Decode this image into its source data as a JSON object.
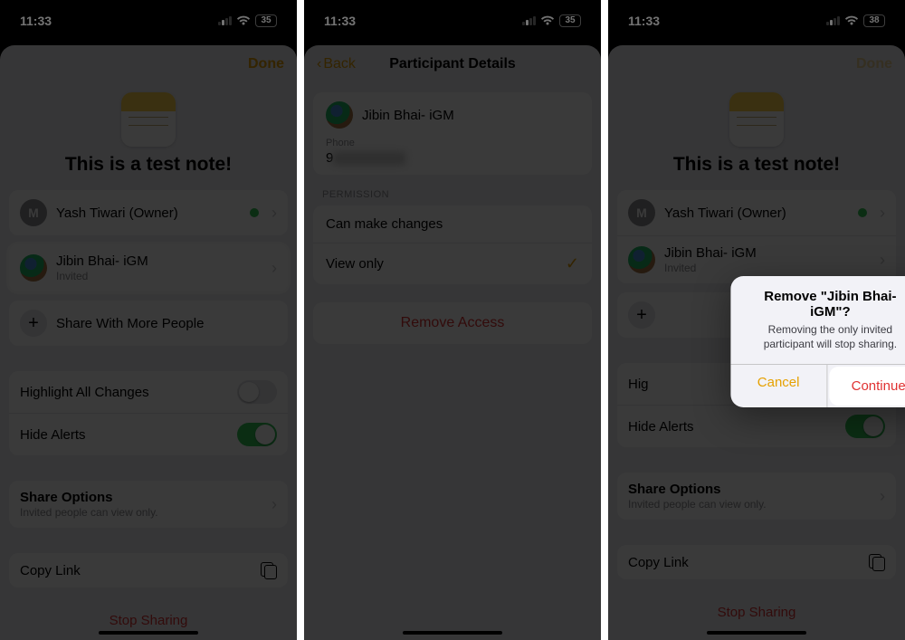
{
  "status": {
    "time": "11:33",
    "battery": "35",
    "battery3": "38"
  },
  "common": {
    "noteTitle": "This is a test note!",
    "done": "Done",
    "ownerInitial": "M",
    "ownerName": "Yash Tiwari (Owner)",
    "participantName": "Jibin Bhai- iGM",
    "participantStatus": "Invited",
    "shareMore": "Share With More People",
    "highlightChanges": "Highlight All Changes",
    "hideAlerts": "Hide Alerts",
    "shareOptionsTitle": "Share Options",
    "shareOptionsSub": "Invited people can view only.",
    "copyLink": "Copy Link",
    "stopSharing": "Stop Sharing"
  },
  "panel2": {
    "back": "Back",
    "title": "Participant Details",
    "phoneLabel": "Phone",
    "phonePrefix": "9",
    "permissionHeader": "PERMISSION",
    "permCanEdit": "Can make changes",
    "permViewOnly": "View only",
    "removeAccess": "Remove Access"
  },
  "panel3": {
    "modalTitle": "Remove \"Jibin Bhai- iGM\"?",
    "modalMsg": "Removing the only invited participant will stop sharing.",
    "cancel": "Cancel",
    "continue": "Continue"
  }
}
